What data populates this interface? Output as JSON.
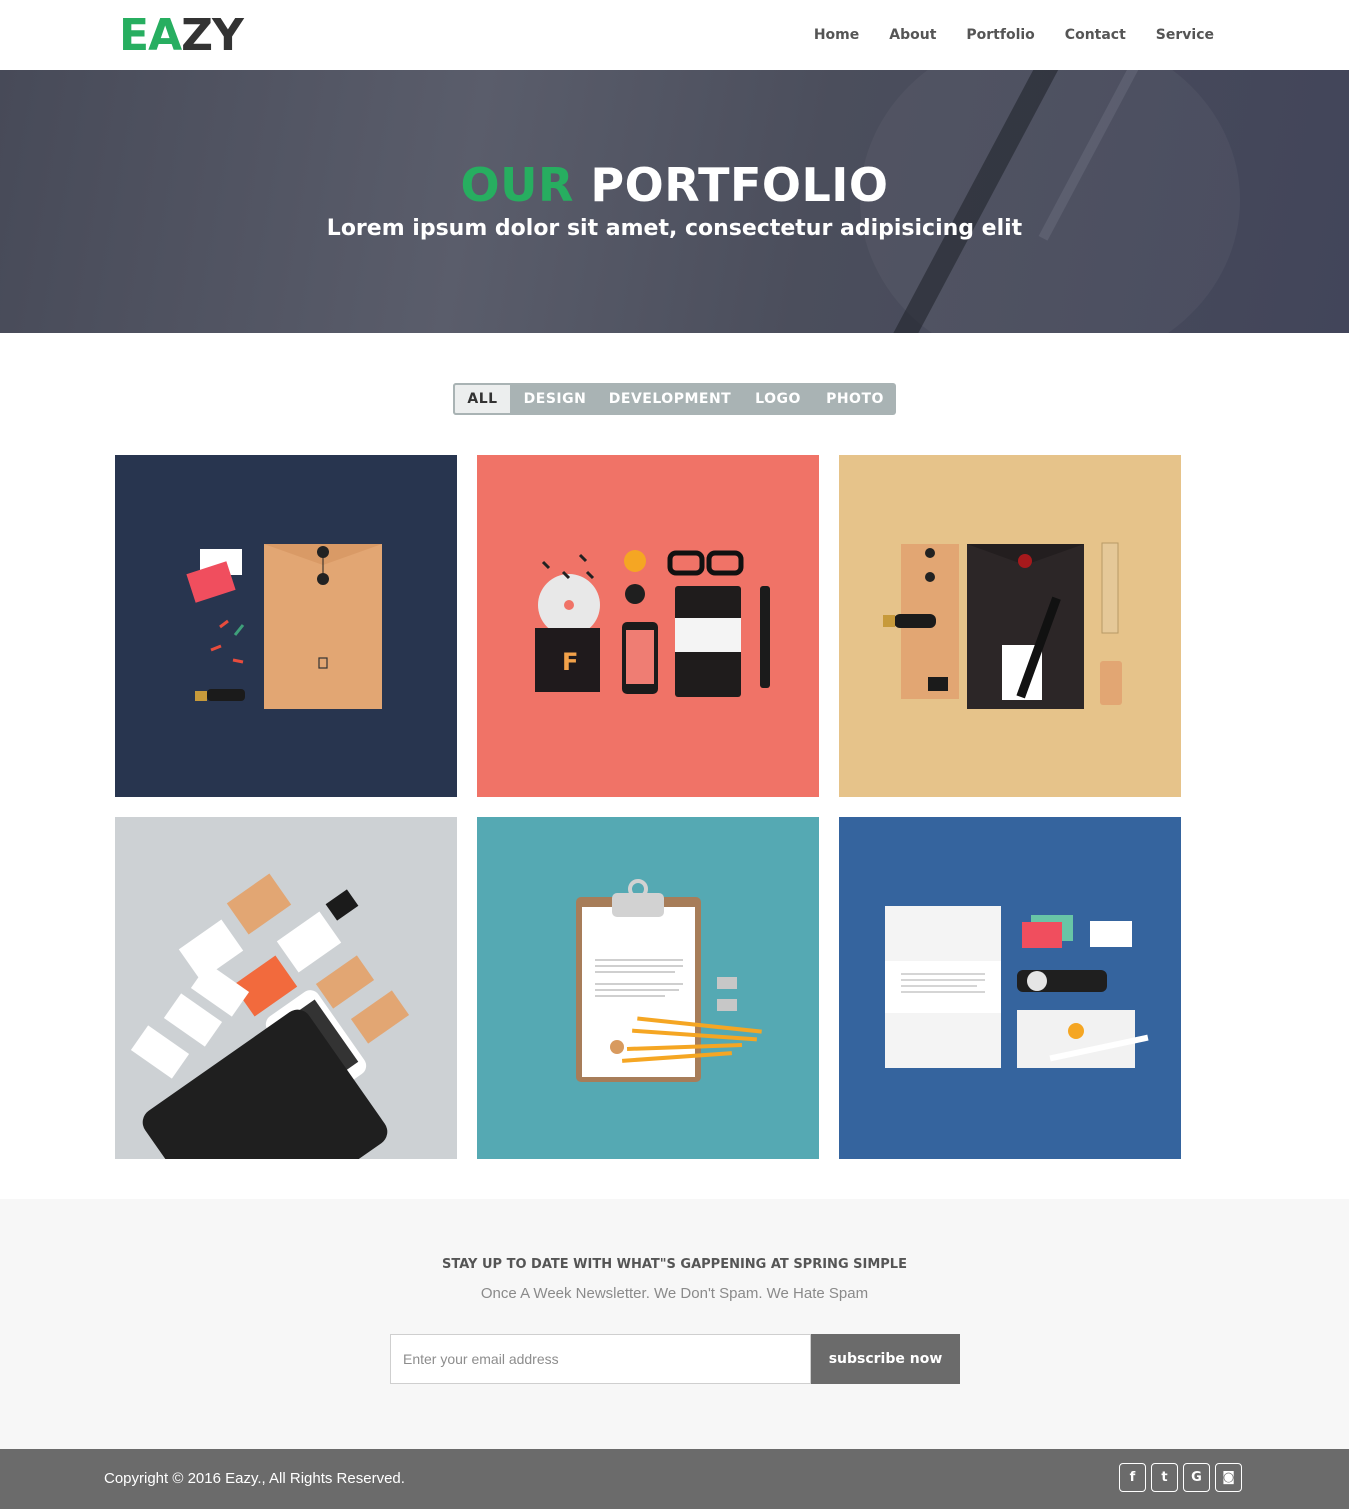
{
  "brand": {
    "logo_e": "E",
    "logo_a": "A",
    "logo_zy": "ZY",
    "accent": "#27ae60"
  },
  "nav": {
    "items": [
      "Home",
      "About",
      "Portfolio",
      "Contact",
      "Service"
    ]
  },
  "hero": {
    "title_accent": "OUR",
    "title_rest": "PORTFOLIO",
    "subtitle": "Lorem ipsum dolor sit amet, consectetur adipisicing elit"
  },
  "filters": {
    "items": [
      "ALL",
      "DESIGN",
      "DEVELOPMENT",
      "LOGO",
      "PHOTO"
    ],
    "active": "ALL"
  },
  "portfolio": {
    "tiles": [
      {
        "bg": "#28354f"
      },
      {
        "bg": "#f07367"
      },
      {
        "bg": "#e6c38a"
      },
      {
        "bg": "#cdd1d4"
      },
      {
        "bg": "#55a9b3"
      },
      {
        "bg": "#35649e"
      }
    ]
  },
  "newsletter": {
    "title": "STAY UP TO DATE WITH WHAT\"S GAPPENING AT SPRING SIMPLE",
    "subtitle": "Once A Week Newsletter. We Don't Spam. We Hate Spam",
    "placeholder": "Enter your email address",
    "button": "subscribe now"
  },
  "footer": {
    "copyright": "Copyright © 2016 Eazy., All Rights Reserved.",
    "social": [
      {
        "icon": "facebook-icon",
        "glyph": "f"
      },
      {
        "icon": "twitter-icon",
        "glyph": "t"
      },
      {
        "icon": "google-icon",
        "glyph": "G"
      },
      {
        "icon": "instagram-icon",
        "glyph": "◙"
      }
    ]
  }
}
